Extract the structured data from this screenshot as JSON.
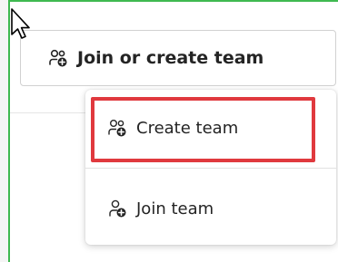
{
  "button": {
    "label": "Join or create team",
    "icon": "people-add-icon"
  },
  "menu": {
    "items": [
      {
        "label": "Create team",
        "icon": "people-add-icon"
      },
      {
        "label": "Join team",
        "icon": "person-add-icon"
      }
    ]
  },
  "colors": {
    "highlight": "#e0393e",
    "frame": "#3fb950",
    "text": "#242424"
  }
}
